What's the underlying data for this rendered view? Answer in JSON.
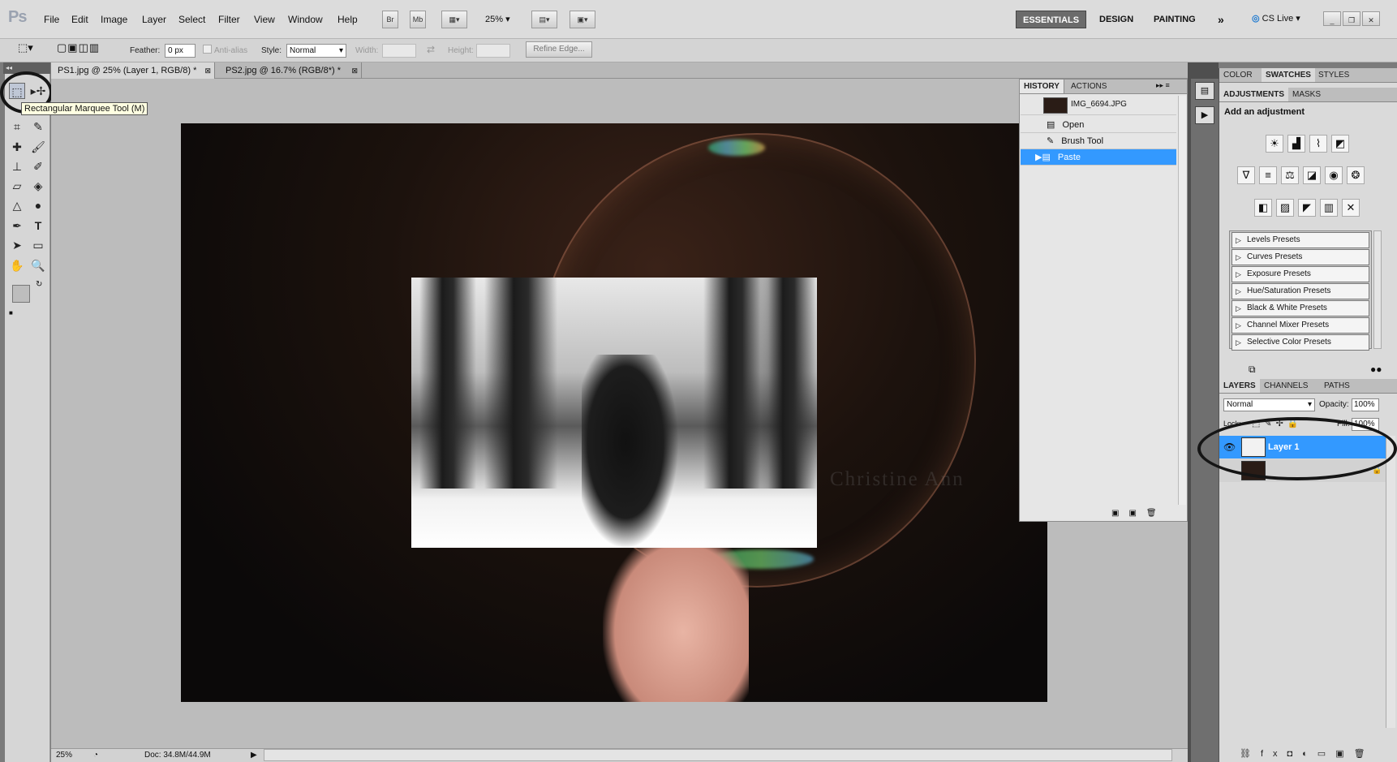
{
  "menubar": {
    "app_logo": "Ps",
    "menus": [
      "File",
      "Edit",
      "Image",
      "Layer",
      "Select",
      "Filter",
      "View",
      "Window",
      "Help"
    ],
    "bridge_btn": "Br",
    "minibridge_btn": "Mb",
    "zoom": "25%",
    "workspaces": [
      "ESSENTIALS",
      "DESIGN",
      "PAINTING"
    ],
    "more": "»",
    "cs_live": "CS Live"
  },
  "options": {
    "feather_label": "Feather:",
    "feather_value": "0 px",
    "antialias_label": "Anti-alias",
    "style_label": "Style:",
    "style_value": "Normal",
    "width_label": "Width:",
    "height_label": "Height:",
    "refine_edge": "Refine Edge..."
  },
  "tools": {
    "tooltip": "Rectangular Marquee Tool (M)"
  },
  "tabs": [
    {
      "label": "PS1.jpg @ 25% (Layer 1, RGB/8) *"
    },
    {
      "label": "PS2.jpg @ 16.7% (RGB/8*) *"
    }
  ],
  "canvas": {
    "watermark": "Christine Ann"
  },
  "history": {
    "tabs": [
      "HISTORY",
      "ACTIONS"
    ],
    "snapshot": "IMG_6694.JPG",
    "items": [
      "Open",
      "Brush Tool",
      "Paste"
    ]
  },
  "right": {
    "color_tabs": [
      "COLOR",
      "SWATCHES",
      "STYLES"
    ],
    "adj_tabs": [
      "ADJUSTMENTS",
      "MASKS"
    ],
    "adj_title": "Add an adjustment",
    "presets": [
      "Levels Presets",
      "Curves Presets",
      "Exposure Presets",
      "Hue/Saturation Presets",
      "Black & White Presets",
      "Channel Mixer Presets",
      "Selective Color Presets"
    ],
    "layer_tabs": [
      "LAYERS",
      "CHANNELS",
      "PATHS"
    ],
    "blend_mode": "Normal",
    "opacity_label": "Opacity:",
    "opacity_value": "100%",
    "lock_label": "Lock:",
    "fill_label": "Fill:",
    "fill_value": "100%",
    "layers": [
      "Layer 1"
    ]
  },
  "status": {
    "zoom": "25%",
    "doc": "Doc: 34.8M/44.9M"
  },
  "colors": {
    "selection_blue": "#3399ff",
    "panel_gray": "#dadada"
  }
}
